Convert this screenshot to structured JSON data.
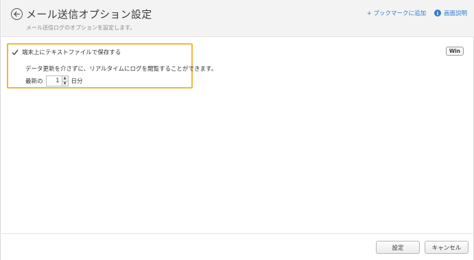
{
  "header": {
    "title": "メール送信オプション設定",
    "subtitle": "メール送信ログのオプションを設定します。",
    "bookmark_link": "+ ブックマークに追加",
    "help_link": "画面説明",
    "help_icon_glyph": "i"
  },
  "platform_badge": "Win",
  "options": {
    "save_local_label": "端末上にテキストファイルで保存する",
    "save_local_checked": true,
    "description": "データ更新を介さずに、リアルタイムにログを閲覧することができます。",
    "latest_prefix": "最新の",
    "days_value": "1",
    "days_suffix": "日分"
  },
  "footer": {
    "ok_label": "設定",
    "cancel_label": "キャンセル"
  },
  "colors": {
    "highlight": "#f0b63a",
    "link": "#2c7bd0"
  }
}
